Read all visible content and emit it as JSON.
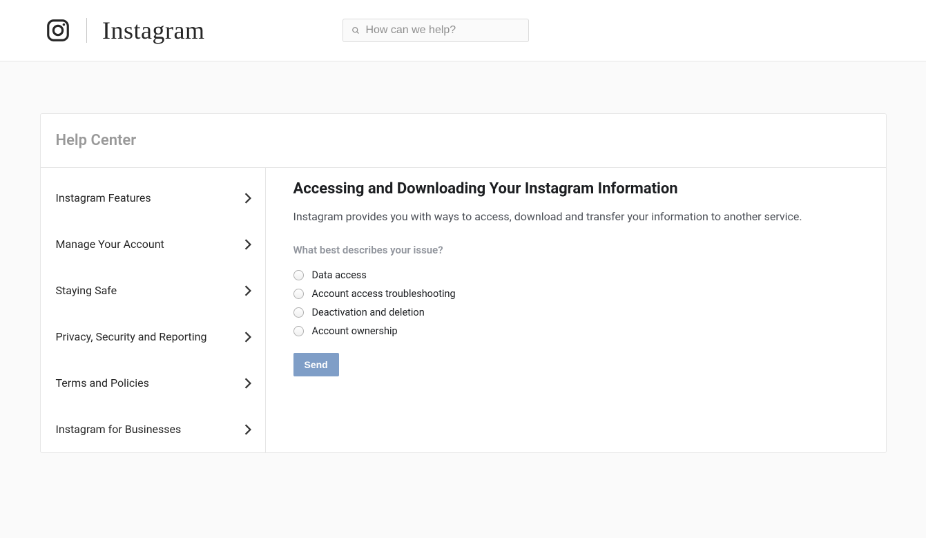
{
  "header": {
    "brand": "Instagram",
    "search_placeholder": "How can we help?"
  },
  "card": {
    "title": "Help Center"
  },
  "sidebar": {
    "items": [
      {
        "label": "Instagram Features"
      },
      {
        "label": "Manage Your Account"
      },
      {
        "label": "Staying Safe"
      },
      {
        "label": "Privacy, Security and Reporting"
      },
      {
        "label": "Terms and Policies"
      },
      {
        "label": "Instagram for Businesses"
      }
    ]
  },
  "main": {
    "heading": "Accessing and Downloading Your Instagram Information",
    "intro": "Instagram provides you with ways to access, download and transfer your information to another service.",
    "question": "What best describes your issue?",
    "options": [
      {
        "label": "Data access"
      },
      {
        "label": "Account access troubleshooting"
      },
      {
        "label": "Deactivation and deletion"
      },
      {
        "label": "Account ownership"
      }
    ],
    "send_label": "Send"
  }
}
